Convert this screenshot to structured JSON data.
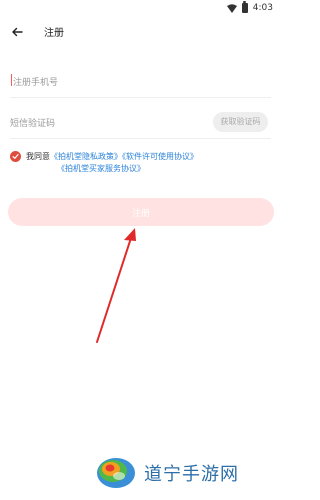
{
  "status_bar": {
    "time": "4:03"
  },
  "header": {
    "title": "注册"
  },
  "phone_field": {
    "placeholder": "注册手机号"
  },
  "code_field": {
    "placeholder": "短信验证码",
    "button_label": "获取验证码"
  },
  "agreement": {
    "prefix": "我同意",
    "link_privacy": "《拍机堂隐私政策》",
    "link_license": "《软件许可使用协议》",
    "link_buyer": "《拍机堂买家服务协议》"
  },
  "register_button": {
    "label": "注册"
  },
  "watermark": {
    "text": "道宁手游网"
  },
  "colors": {
    "accent": "#e04b3f",
    "link": "#2b83d9",
    "button_bg": "#ffe2e1"
  }
}
